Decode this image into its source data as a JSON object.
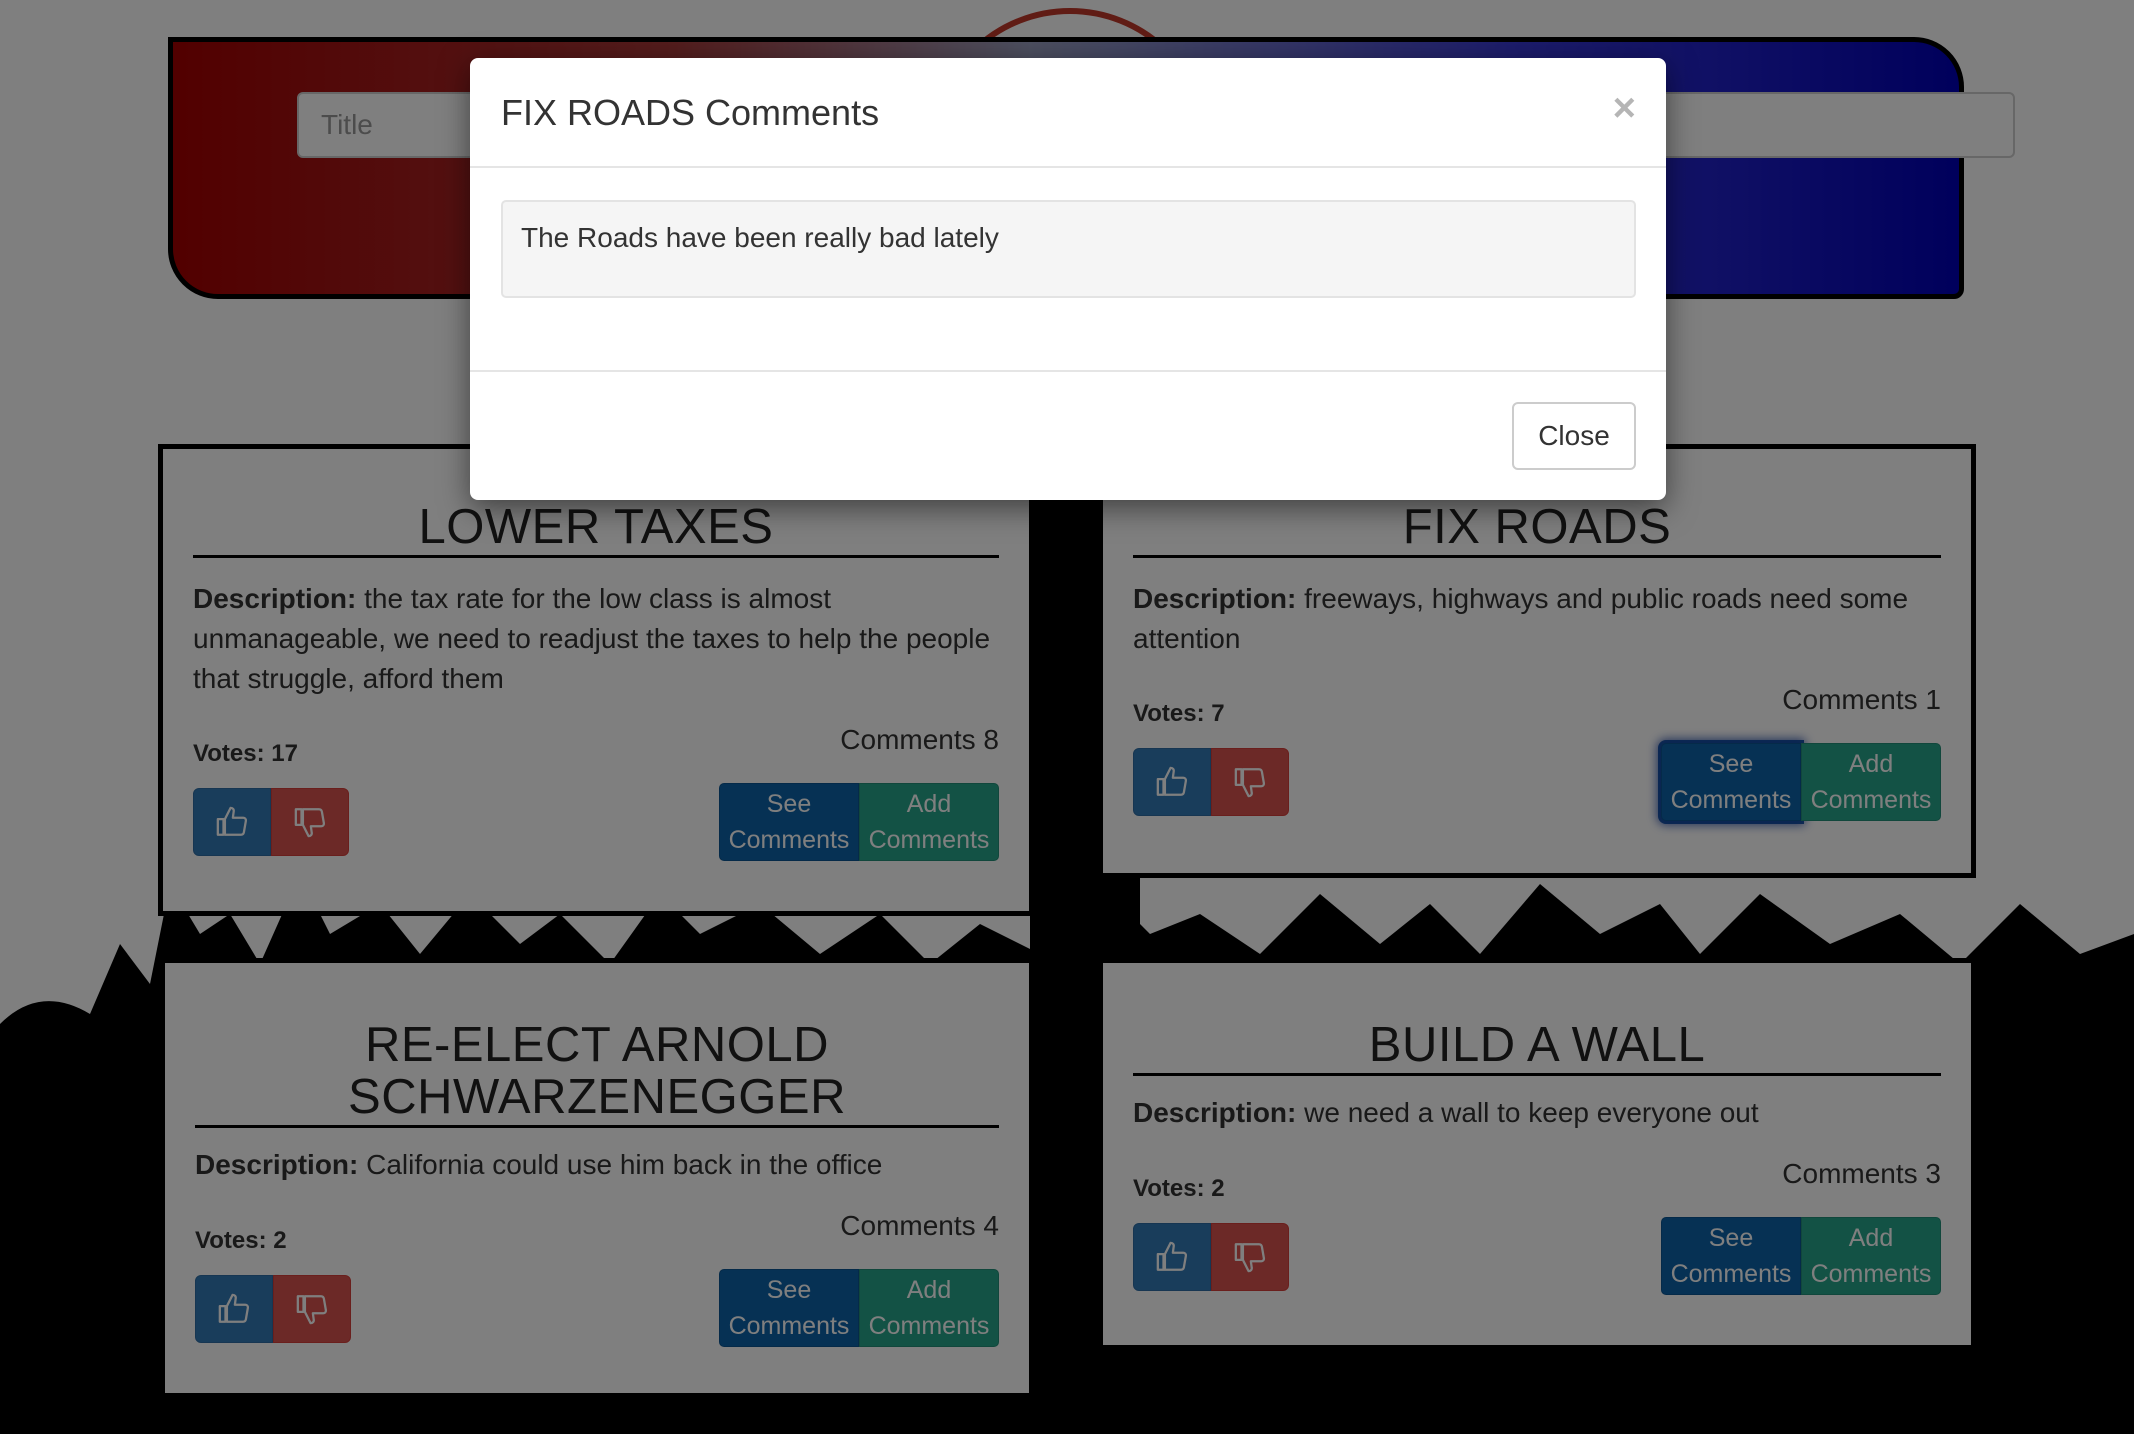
{
  "header": {
    "title_placeholder": "Title",
    "description_placeholder": ""
  },
  "cards": [
    {
      "title": "LOWER TAXES",
      "description_label": "Description:",
      "description": "the tax rate for the low class is almost unmanageable, we need to readjust the taxes to help the people that struggle, afford them",
      "votes": "Votes: 17",
      "comments": "Comments 8",
      "see_label": "See Comments",
      "add_label": "Add Comments"
    },
    {
      "title": "FIX ROADS",
      "description_label": "Description:",
      "description": "freeways, highways and public roads need some attention",
      "votes": "Votes: 7",
      "comments": "Comments 1",
      "see_label": "See Comments",
      "add_label": "Add Comments"
    },
    {
      "title": "RE-ELECT ARNOLD SCHWARZENEGGER",
      "description_label": "Description:",
      "description": "California could use him back in the office",
      "votes": "Votes: 2",
      "comments": "Comments 4",
      "see_label": "See Comments",
      "add_label": "Add Comments"
    },
    {
      "title": "BUILD A WALL",
      "description_label": "Description:",
      "description": "we need a wall to keep everyone out",
      "votes": "Votes: 2",
      "comments": "Comments 3",
      "see_label": "See Comments",
      "add_label": "Add Comments"
    }
  ],
  "modal": {
    "title": "FIX ROADS Comments",
    "close_symbol": "×",
    "comments": [
      "The Roads have been really bad lately"
    ],
    "close_label": "Close"
  },
  "icons": {
    "upvote": "thumbs-up-icon",
    "downvote": "thumbs-down-icon"
  },
  "colors": {
    "upvote": "#337ab7",
    "downvote": "#d9534f",
    "see_comments": "#0d62a8",
    "add_comments": "#27a58a"
  }
}
